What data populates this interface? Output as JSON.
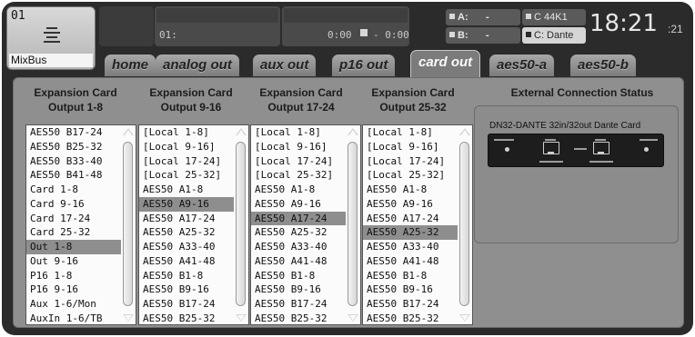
{
  "header": {
    "channel_number": "01",
    "channel_name": "MixBus",
    "scene_label": "01:",
    "time_a": "0:00",
    "time_b": "- 0:00",
    "a_label": "A:",
    "a_value": "-",
    "b_label": "B:",
    "b_value": "-",
    "rate": "C 44K1",
    "card_label": "C: Dante",
    "clock": "18:21",
    "clock_seconds": ":21"
  },
  "tabs": [
    "home",
    "analog out",
    "aux out",
    "p16 out",
    "card out",
    "aes50-a",
    "aes50-b"
  ],
  "active_tab": "card out",
  "columns": [
    {
      "title_line1": "Expansion Card",
      "title_line2": "Output 1-8",
      "items": [
        "AES50 B17-24",
        "AES50 B25-32",
        "AES50 B33-40",
        "AES50 B41-48",
        "Card 1-8",
        "Card 9-16",
        "Card 17-24",
        "Card 25-32",
        "Out 1-8",
        "Out 9-16",
        "P16 1-8",
        "P16 9-16",
        "Aux 1-6/Mon",
        "AuxIn 1-6/TB"
      ],
      "selected": "Out 1-8"
    },
    {
      "title_line1": "Expansion Card",
      "title_line2": "Output 9-16",
      "items": [
        "[Local 1-8]",
        "[Local 9-16]",
        "[Local 17-24]",
        "[Local 25-32]",
        "AES50 A1-8",
        "AES50 A9-16",
        "AES50 A17-24",
        "AES50 A25-32",
        "AES50 A33-40",
        "AES50 A41-48",
        "AES50 B1-8",
        "AES50 B9-16",
        "AES50 B17-24",
        "AES50 B25-32"
      ],
      "selected": "AES50 A9-16"
    },
    {
      "title_line1": "Expansion Card",
      "title_line2": "Output 17-24",
      "items": [
        "[Local 1-8]",
        "[Local 9-16]",
        "[Local 17-24]",
        "[Local 25-32]",
        "AES50 A1-8",
        "AES50 A9-16",
        "AES50 A17-24",
        "AES50 A25-32",
        "AES50 A33-40",
        "AES50 A41-48",
        "AES50 B1-8",
        "AES50 B9-16",
        "AES50 B17-24",
        "AES50 B25-32"
      ],
      "selected": "AES50 A17-24"
    },
    {
      "title_line1": "Expansion Card",
      "title_line2": "Output 25-32",
      "items": [
        "[Local 1-8]",
        "[Local 9-16]",
        "[Local 17-24]",
        "[Local 25-32]",
        "AES50 A1-8",
        "AES50 A9-16",
        "AES50 A17-24",
        "AES50 A25-32",
        "AES50 A33-40",
        "AES50 A41-48",
        "AES50 B1-8",
        "AES50 B9-16",
        "AES50 B17-24",
        "AES50 B25-32"
      ],
      "selected": "AES50 A25-32"
    }
  ],
  "external": {
    "title": "External Connection Status",
    "card_name": "DN32-DANTE 32in/32out Dante Card"
  },
  "icons": {
    "channel": "mixbus-icon",
    "scroll_up": "triangle-up-icon",
    "scroll_down": "triangle-down-icon"
  },
  "colors": {
    "background": "#2b2b2b",
    "panel": "#8f8f8f",
    "selected_row": "#8e8e8e"
  }
}
